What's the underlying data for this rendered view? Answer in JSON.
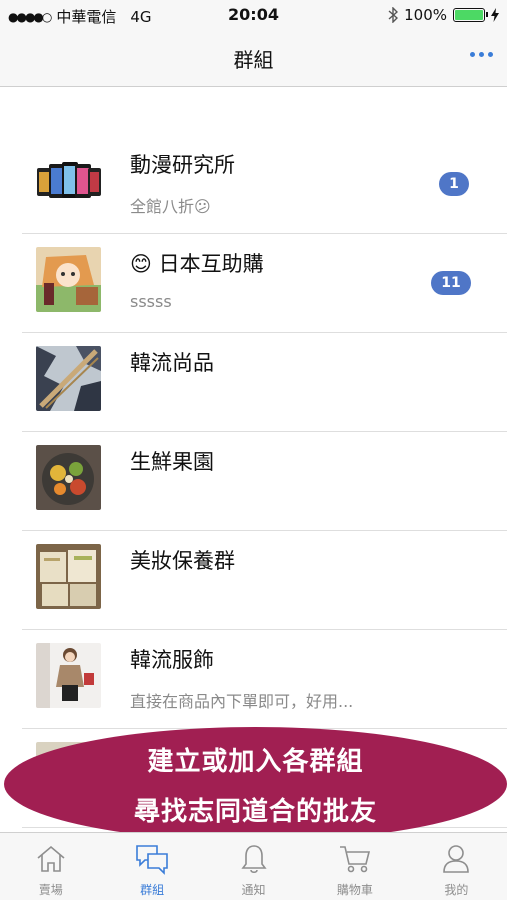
{
  "status_bar": {
    "carrier": "中華電信",
    "network": "4G",
    "time": "20:04",
    "battery": "100%",
    "battery_level": 1.0
  },
  "nav": {
    "title": "群組",
    "more_icon": "ellipsis-icon"
  },
  "groups": [
    {
      "name": "動漫研究所",
      "subtitle": "全館八折😕",
      "badge": "1"
    },
    {
      "name": "😊 日本互助購",
      "subtitle": "sssss",
      "badge": "11"
    },
    {
      "name": "韓流尚品",
      "subtitle": "",
      "badge": ""
    },
    {
      "name": "生鮮果園",
      "subtitle": "",
      "badge": ""
    },
    {
      "name": "美妝保養群",
      "subtitle": "",
      "badge": ""
    },
    {
      "name": "韓流服飾",
      "subtitle": "直接在商品內下單即可，好用...",
      "badge": ""
    }
  ],
  "promo": {
    "line1": "建立或加入各群組",
    "line2": "尋找志同道合的批友"
  },
  "tabs": [
    {
      "label": "賣場",
      "icon": "home-icon"
    },
    {
      "label": "群組",
      "icon": "chat-bubbles-icon",
      "active": true
    },
    {
      "label": "通知",
      "icon": "bell-icon"
    },
    {
      "label": "購物車",
      "icon": "cart-icon"
    },
    {
      "label": "我的",
      "icon": "person-icon"
    }
  ],
  "colors": {
    "accent": "#3b7dd8",
    "badge": "#4f76c7",
    "promo": "#a11f52",
    "battery": "#4cd964"
  }
}
